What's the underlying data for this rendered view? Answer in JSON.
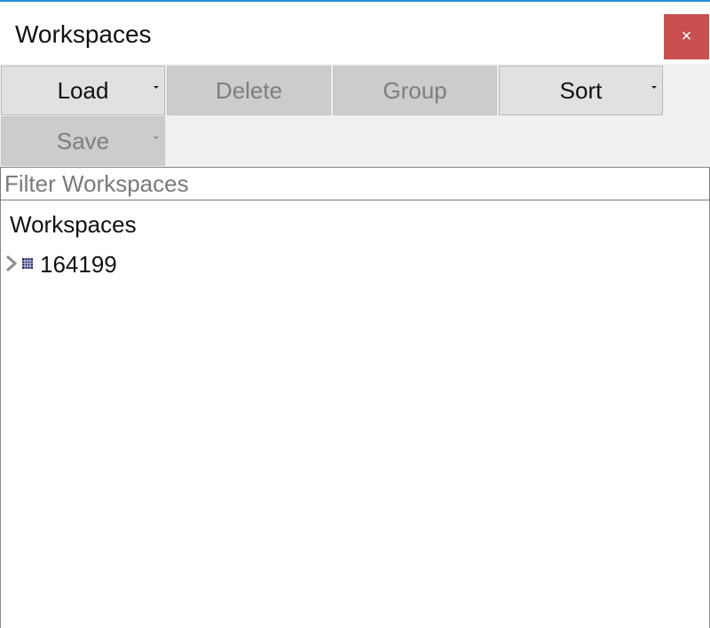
{
  "window": {
    "title": "Workspaces",
    "close_label": "×",
    "accent_color": "#1e8fd8",
    "close_color": "#c9504f"
  },
  "toolbar": {
    "load_label": "Load",
    "delete_label": "Delete",
    "group_label": "Group",
    "sort_label": "Sort",
    "save_label": "Save"
  },
  "filter": {
    "value": "",
    "placeholder": "Filter Workspaces"
  },
  "tree": {
    "header": "Workspaces",
    "items": [
      {
        "label": "164199",
        "icon": "table-icon",
        "expand_icon": "chevron-right-icon"
      }
    ]
  }
}
